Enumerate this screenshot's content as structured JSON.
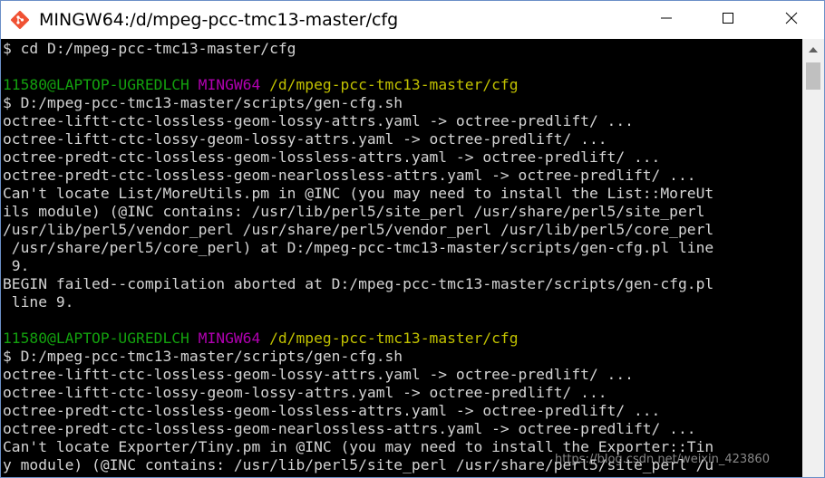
{
  "window": {
    "title": "MINGW64:/d/mpeg-pcc-tmc13-master/cfg",
    "icon": "git-bash-icon",
    "controls": [
      "minimize-icon",
      "maximize-icon",
      "close-icon"
    ]
  },
  "colors": {
    "green": "#13a10e",
    "magenta": "#b100b1",
    "yellow": "#c1c100",
    "text": "#d4d4d4",
    "background": "#000000"
  },
  "terminal": {
    "lines": [
      [
        {
          "t": "$ cd D:/mpeg-pcc-tmc13-master/cfg",
          "c": "white"
        }
      ],
      [
        {
          "t": "",
          "c": "white"
        }
      ],
      [
        {
          "t": "11580@LAPTOP-UGREDLCH ",
          "c": "green"
        },
        {
          "t": "MINGW64 ",
          "c": "magenta"
        },
        {
          "t": "/d/mpeg-pcc-tmc13-master/cfg",
          "c": "yellow"
        }
      ],
      [
        {
          "t": "$ D:/mpeg-pcc-tmc13-master/scripts/gen-cfg.sh",
          "c": "white"
        }
      ],
      [
        {
          "t": "octree-liftt-ctc-lossless-geom-lossy-attrs.yaml -> octree-predlift/ ...",
          "c": "white"
        }
      ],
      [
        {
          "t": "octree-liftt-ctc-lossy-geom-lossy-attrs.yaml -> octree-predlift/ ...",
          "c": "white"
        }
      ],
      [
        {
          "t": "octree-predt-ctc-lossless-geom-lossless-attrs.yaml -> octree-predlift/ ...",
          "c": "white"
        }
      ],
      [
        {
          "t": "octree-predt-ctc-lossless-geom-nearlossless-attrs.yaml -> octree-predlift/ ...",
          "c": "white"
        }
      ],
      [
        {
          "t": "Can't locate List/MoreUtils.pm in @INC (you may need to install the List::MoreUt",
          "c": "white"
        }
      ],
      [
        {
          "t": "ils module) (@INC contains: /usr/lib/perl5/site_perl /usr/share/perl5/site_perl",
          "c": "white"
        }
      ],
      [
        {
          "t": "/usr/lib/perl5/vendor_perl /usr/share/perl5/vendor_perl /usr/lib/perl5/core_perl",
          "c": "white"
        }
      ],
      [
        {
          "t": " /usr/share/perl5/core_perl) at D:/mpeg-pcc-tmc13-master/scripts/gen-cfg.pl line",
          "c": "white"
        }
      ],
      [
        {
          "t": " 9.",
          "c": "white"
        }
      ],
      [
        {
          "t": "BEGIN failed--compilation aborted at D:/mpeg-pcc-tmc13-master/scripts/gen-cfg.pl",
          "c": "white"
        }
      ],
      [
        {
          "t": " line 9.",
          "c": "white"
        }
      ],
      [
        {
          "t": "",
          "c": "white"
        }
      ],
      [
        {
          "t": "11580@LAPTOP-UGREDLCH ",
          "c": "green"
        },
        {
          "t": "MINGW64 ",
          "c": "magenta"
        },
        {
          "t": "/d/mpeg-pcc-tmc13-master/cfg",
          "c": "yellow"
        }
      ],
      [
        {
          "t": "$ D:/mpeg-pcc-tmc13-master/scripts/gen-cfg.sh",
          "c": "white"
        }
      ],
      [
        {
          "t": "octree-liftt-ctc-lossless-geom-lossy-attrs.yaml -> octree-predlift/ ...",
          "c": "white"
        }
      ],
      [
        {
          "t": "octree-liftt-ctc-lossy-geom-lossy-attrs.yaml -> octree-predlift/ ...",
          "c": "white"
        }
      ],
      [
        {
          "t": "octree-predt-ctc-lossless-geom-lossless-attrs.yaml -> octree-predlift/ ...",
          "c": "white"
        }
      ],
      [
        {
          "t": "octree-predt-ctc-lossless-geom-nearlossless-attrs.yaml -> octree-predlift/ ...",
          "c": "white"
        }
      ],
      [
        {
          "t": "Can't locate Exporter/Tiny.pm in @INC (you may need to install the Exporter::Tin",
          "c": "white"
        }
      ],
      [
        {
          "t": "y module) (@INC contains: /usr/lib/perl5/site_perl /usr/share/perl5/site_perl /u",
          "c": "white"
        }
      ]
    ]
  },
  "watermark": "https://blog.csdn.net/weixin_423860"
}
